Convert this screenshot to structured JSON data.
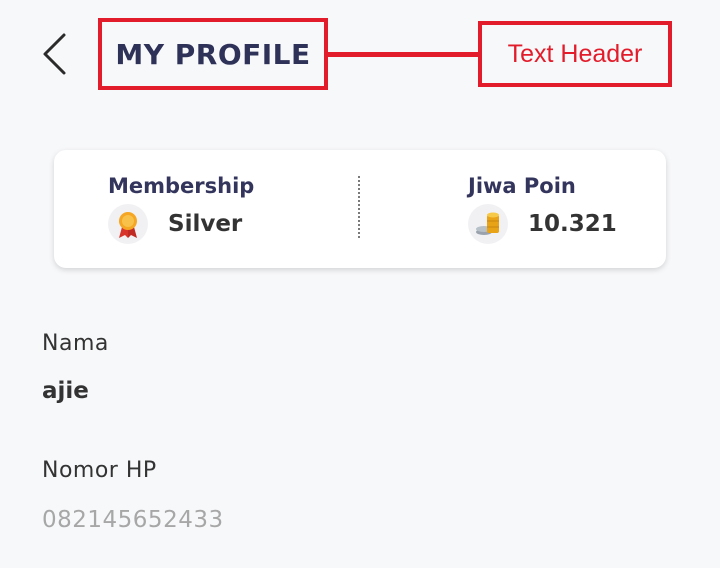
{
  "header": {
    "back_icon": "chevron-left-icon",
    "title": "MY PROFILE",
    "annotation": "Text Header",
    "annotation_color": "#e21c2a",
    "title_color": "#2f3258"
  },
  "summary_card": {
    "membership": {
      "label": "Membership",
      "value": "Silver",
      "icon": "medal-icon"
    },
    "points": {
      "label": "Jiwa Poin",
      "value": "10.321",
      "icon": "coins-icon"
    }
  },
  "profile": {
    "name_label": "Nama",
    "name_value": "ajie",
    "phone_label": "Nomor HP",
    "phone_value": "082145652433"
  }
}
